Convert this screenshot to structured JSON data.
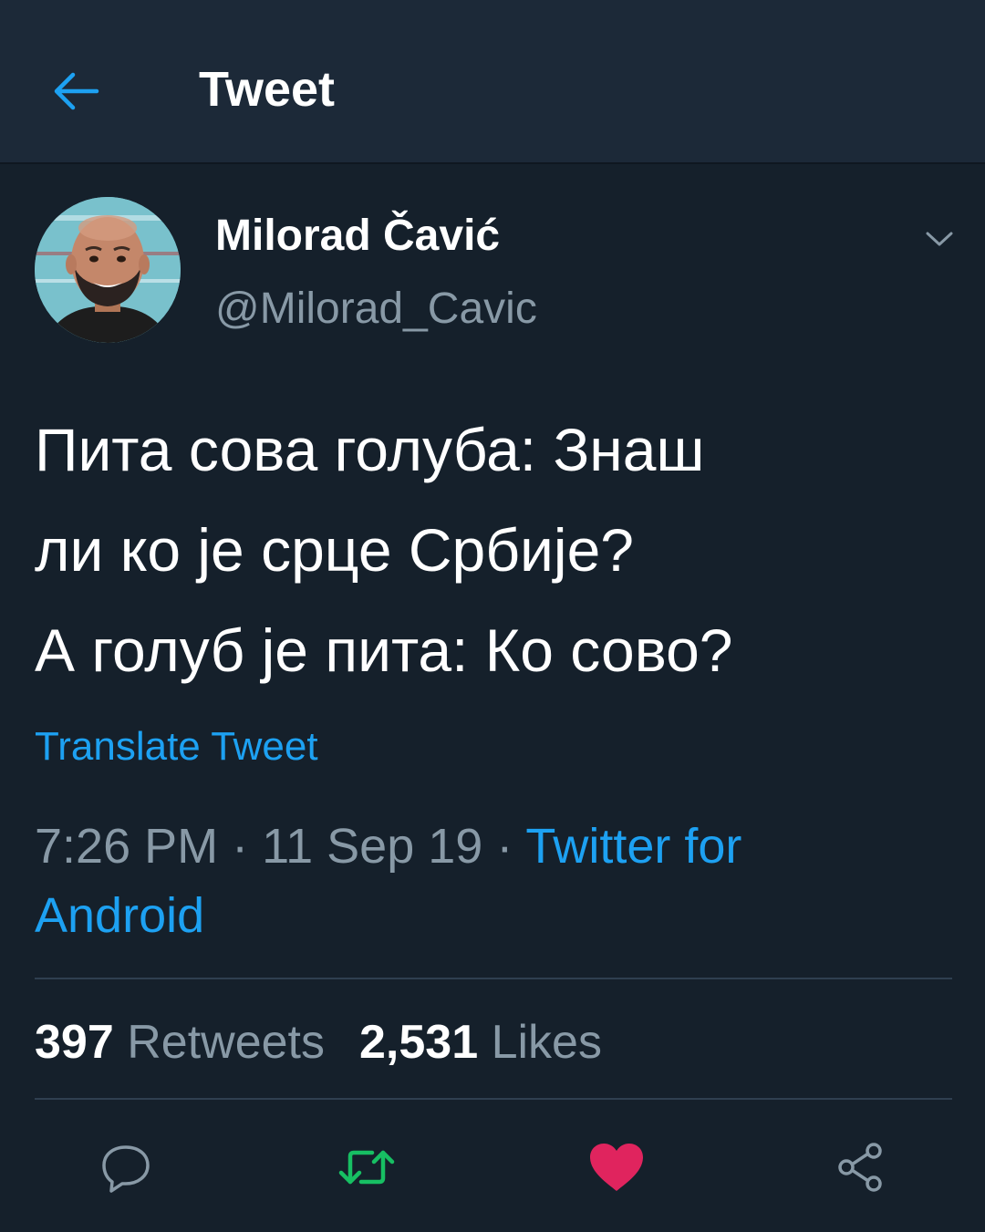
{
  "header": {
    "title": "Tweet",
    "back_icon": "back-arrow-icon",
    "accent_color": "#1da1f2"
  },
  "author": {
    "display_name": "Milorad Čavić",
    "handle": "@Milorad_Cavic",
    "avatar_icon": "profile-photo"
  },
  "tweet": {
    "lines": [
      "Пита сова голуба: Знаш",
      "ли ко је срце Србије?",
      "А голуб је пита: Ко сово?"
    ],
    "translate_label": "Translate Tweet",
    "time": "7:26 PM",
    "separator": " · ",
    "date": "11 Sep 19",
    "source_line1": "Twitter for",
    "source_line2": "Android"
  },
  "stats": {
    "retweets_count": "397",
    "retweets_label": "Retweets",
    "likes_count": "2,531",
    "likes_label": "Likes"
  },
  "actions": {
    "reply_icon": "reply-icon",
    "retweet_icon": "retweet-icon",
    "like_icon": "heart-icon",
    "share_icon": "share-icon",
    "retweet_color": "#17bf63",
    "like_color": "#e0245e"
  }
}
